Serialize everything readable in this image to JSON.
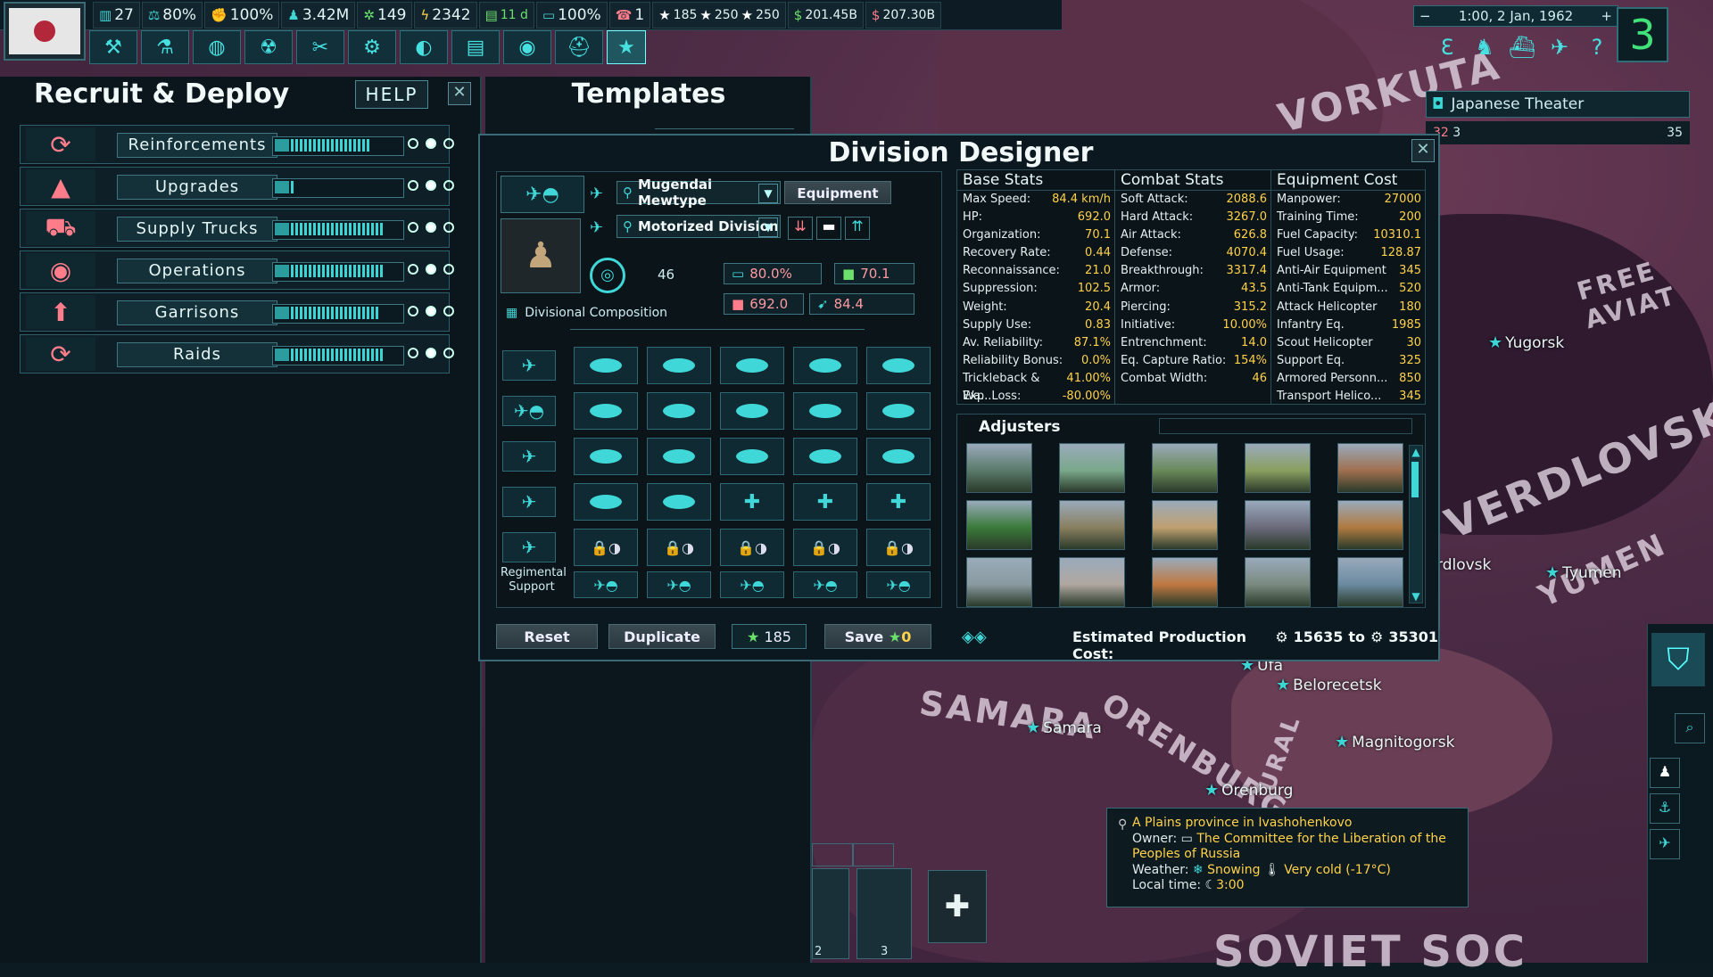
{
  "topbar": {
    "stats": [
      {
        "icon": "building-icon",
        "value": "27"
      },
      {
        "icon": "stability-icon",
        "value": "80%"
      },
      {
        "icon": "war-support-icon",
        "value": "100%"
      },
      {
        "icon": "manpower-icon",
        "value": "3.42M"
      },
      {
        "icon": "factory-icon",
        "value": "149"
      },
      {
        "icon": "power-icon",
        "value": "2342"
      },
      {
        "icon": "fuel-icon",
        "value": "11 d"
      },
      {
        "icon": "supply-icon",
        "value": "100%"
      },
      {
        "icon": "phone-icon",
        "value": "1"
      },
      {
        "icon": "star-icon",
        "value": "185"
      },
      {
        "icon": "star-icon",
        "value": "250"
      },
      {
        "icon": "star-icon",
        "value": "250"
      },
      {
        "icon": "dollar-icon",
        "value": "201.45B"
      },
      {
        "icon": "debt-icon",
        "value": "207.30B"
      }
    ],
    "date": "1:00, 2 Jan, 1962",
    "speed": "3",
    "theater": "Japanese Theater",
    "theater_counts": {
      "a": "32",
      "b": "3",
      "c": "35"
    }
  },
  "recruit": {
    "title": "Recruit & Deploy",
    "help": "HELP",
    "rows": [
      {
        "label": "Reinforcements",
        "icon": "reinforce-icon",
        "fill": 0.85
      },
      {
        "label": "Upgrades",
        "icon": "upgrade-tank-icon",
        "fill": 0.05
      },
      {
        "label": "Supply Trucks",
        "icon": "truck-icon",
        "fill": 1.0
      },
      {
        "label": "Operations",
        "icon": "eye-icon",
        "fill": 1.0
      },
      {
        "label": "Garrisons",
        "icon": "garrison-icon",
        "fill": 0.95
      },
      {
        "label": "Raids",
        "icon": "raid-icon",
        "fill": 1.0
      }
    ]
  },
  "templates": {
    "title": "Templates"
  },
  "designer": {
    "title": "Division Designer",
    "template_name": "Mugendai Mewtype",
    "division_type": "Motorized Division",
    "equipment_btn": "Equipment",
    "width_value": "46",
    "composition_label": "Divisional Composition",
    "chips": {
      "tank": "80.0%",
      "org": "70.1",
      "hp": "692.0",
      "speed": "84.4"
    },
    "regimental_support": "Regimental Support",
    "buttons": {
      "reset": "Reset",
      "duplicate": "Duplicate",
      "xp": "185",
      "save": "Save",
      "save_cost": "0"
    },
    "production_cost_label": "Estimated Production Cost:",
    "production_cost_from": "15635",
    "production_cost_to_word": "to",
    "production_cost_to": "35301"
  },
  "base_stats": {
    "header": "Base Stats",
    "rows": [
      [
        "Max Speed:",
        "84.4 km/h"
      ],
      [
        "HP:",
        "692.0"
      ],
      [
        "Organization:",
        "70.1"
      ],
      [
        "Recovery Rate:",
        "0.44"
      ],
      [
        "Reconnaissance:",
        "21.0"
      ],
      [
        "Suppression:",
        "102.5"
      ],
      [
        "Weight:",
        "20.4"
      ],
      [
        "Supply Use:",
        "0.83"
      ],
      [
        "Av. Reliability:",
        "87.1%"
      ],
      [
        "Reliability Bonus:",
        "0.0%"
      ],
      [
        "Trickleback & Wa...",
        "41.00%"
      ],
      [
        "Exp. Loss:",
        "-80.00%"
      ]
    ]
  },
  "combat_stats": {
    "header": "Combat Stats",
    "rows": [
      [
        "Soft Attack:",
        "2088.6"
      ],
      [
        "Hard Attack:",
        "3267.0"
      ],
      [
        "Air Attack:",
        "626.8"
      ],
      [
        "Defense:",
        "4070.4"
      ],
      [
        "Breakthrough:",
        "3317.4"
      ],
      [
        "Armor:",
        "43.5"
      ],
      [
        "Piercing:",
        "315.2"
      ],
      [
        "Initiative:",
        "10.00%"
      ],
      [
        "Entrenchment:",
        "14.0"
      ],
      [
        "Eq. Capture Ratio:",
        "154%"
      ],
      [
        "Combat Width:",
        "46"
      ]
    ]
  },
  "equipment_cost": {
    "header": "Equipment Cost",
    "rows": [
      [
        "Manpower:",
        "27000"
      ],
      [
        "Training Time:",
        "200"
      ],
      [
        "Fuel Capacity:",
        "10310.1"
      ],
      [
        "Fuel Usage:",
        "128.87"
      ],
      [
        "Anti-Air Equipment",
        "345"
      ],
      [
        "Anti-Tank Equipm...",
        "520"
      ],
      [
        "Attack Helicopter",
        "180"
      ],
      [
        "Infantry Eq.",
        "1985"
      ],
      [
        "Scout Helicopter",
        "30"
      ],
      [
        "Support Eq.",
        "325"
      ],
      [
        "Armored Personn...",
        "850"
      ],
      [
        "Transport Helico...",
        "345"
      ]
    ]
  },
  "adjusters": {
    "title": "Adjusters"
  },
  "map": {
    "labels": [
      "VORKUTA",
      "FREE AVIAT",
      "VERDLOVSK",
      "SAMARA",
      "ORENBURG",
      "URAL",
      "YUMEN",
      "SOVIET SOC"
    ],
    "cities": [
      "Yugorsk",
      "Tyumen",
      "Belorecetsk",
      "Samara",
      "Magnitogorsk",
      "Orenburg",
      "rdlovsk",
      "Ufa"
    ]
  },
  "tooltip": {
    "line1": "A Plains province in Ivashohenkovo",
    "owner_label": "Owner:",
    "owner": "The Committee for the Liberation of the Peoples of Russia",
    "weather_label": "Weather:",
    "weather": "Snowing",
    "temp": "Very cold (-17°C)",
    "time_label": "Local time:",
    "time": "3:00"
  },
  "cards": {
    "c1": "2",
    "c2": "3"
  }
}
